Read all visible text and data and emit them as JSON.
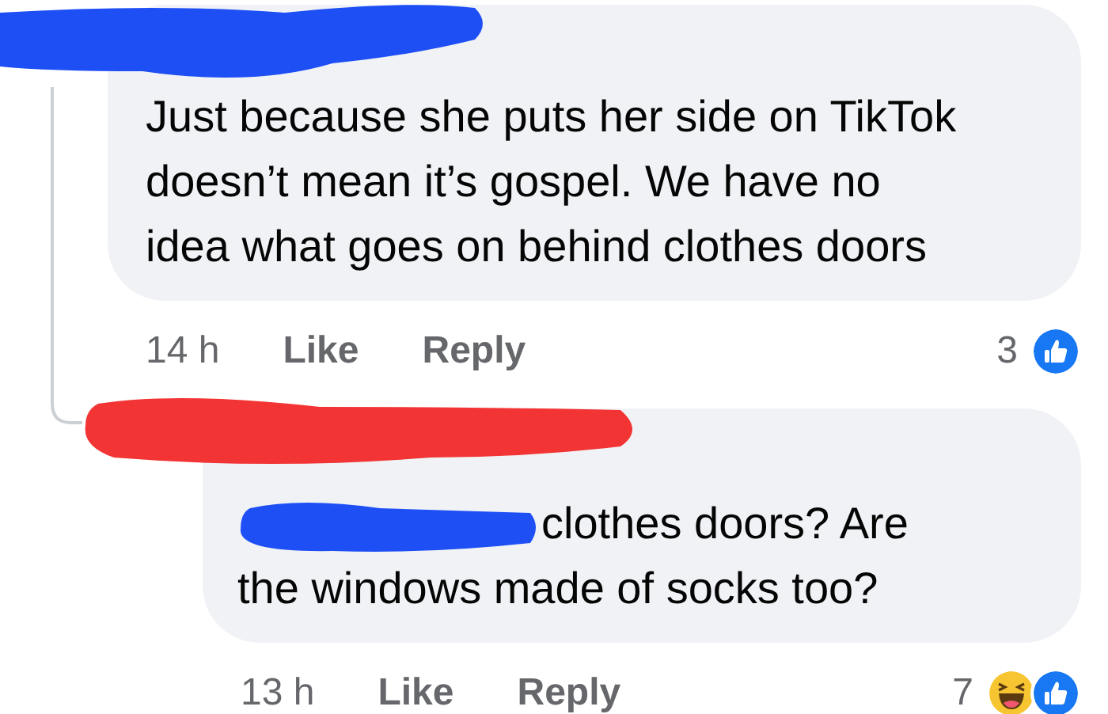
{
  "comments": [
    {
      "text": "Just because she puts her side on TikTok doesn’t mean it’s gospel. We have no idea what goes on behind clothes doors",
      "time": "14 h",
      "actions": [
        "Like",
        "Reply"
      ],
      "reaction_count": "3",
      "reactions": [
        {
          "kind": "like"
        }
      ],
      "replies": [
        {
          "text": "clothes doors? Are the windows made of socks too?",
          "time": "13 h",
          "actions": [
            "Like",
            "Reply"
          ],
          "reaction_count": "7",
          "reactions": [
            {
              "kind": "haha"
            },
            {
              "kind": "like"
            }
          ]
        }
      ]
    }
  ]
}
